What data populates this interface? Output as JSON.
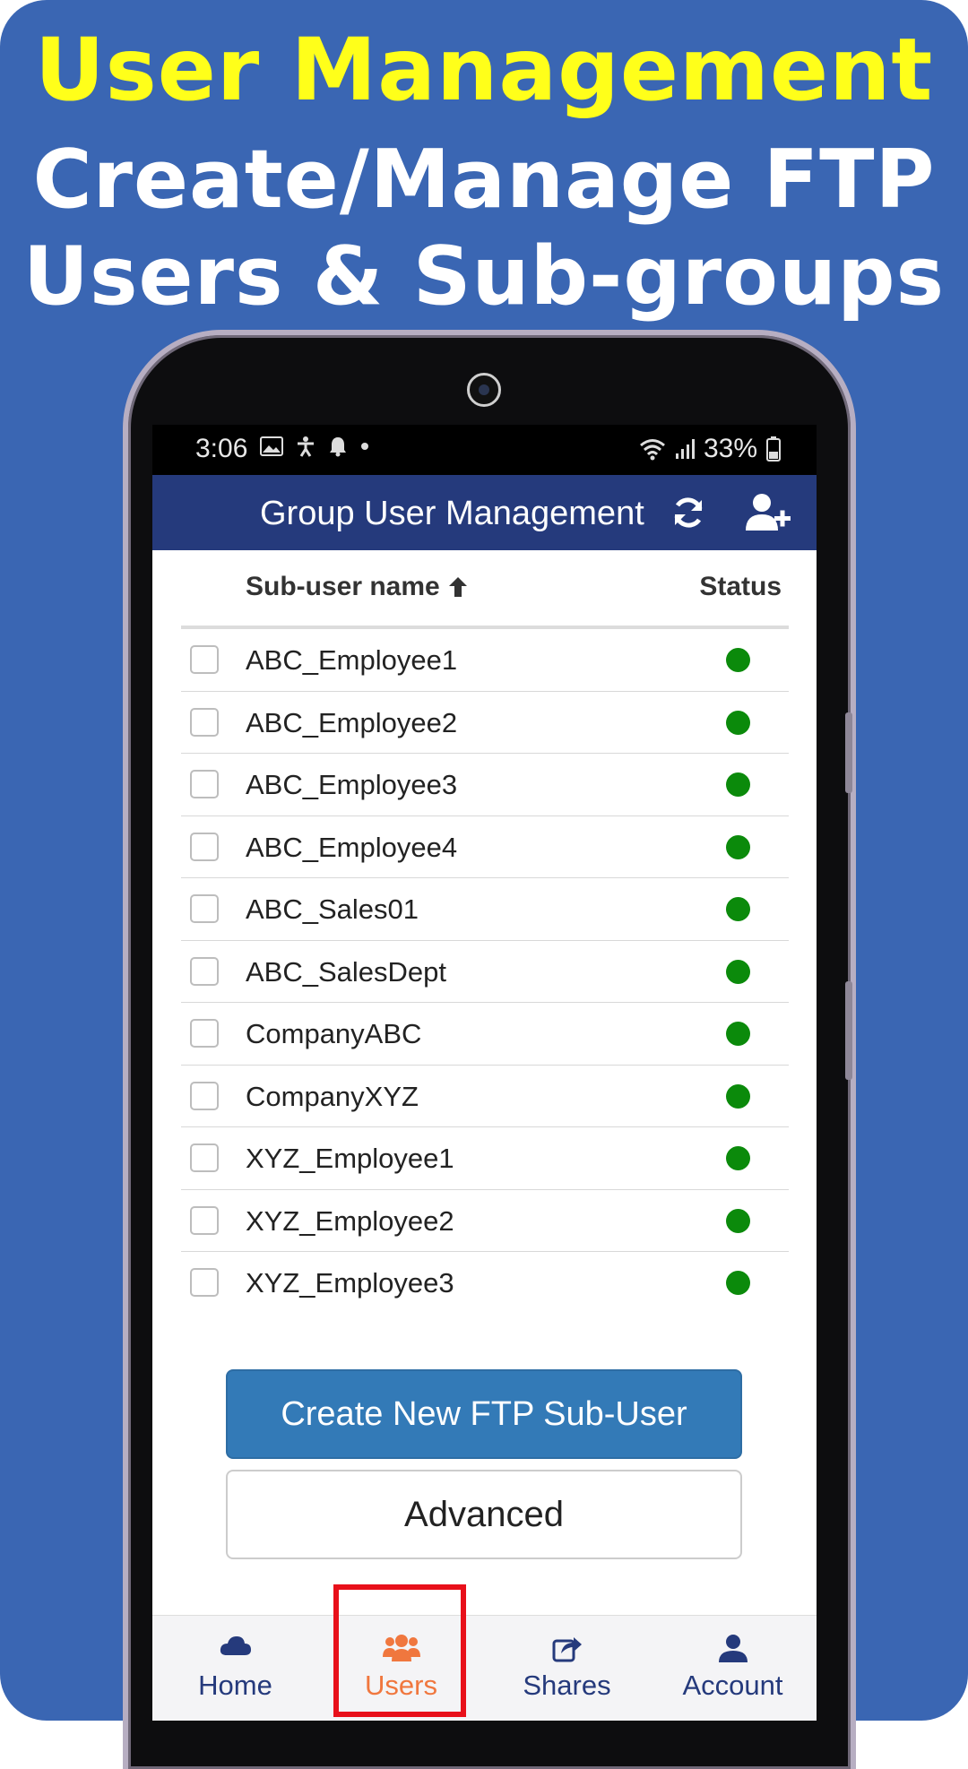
{
  "promo": {
    "title": "User Management",
    "subtitle_line1": "Create/Manage FTP",
    "subtitle_line2": "Users & Sub-groups"
  },
  "status_bar": {
    "time": "3:06",
    "battery": "33%",
    "left_icons": [
      "image-icon",
      "accessibility-icon",
      "bell-icon",
      "dot-icon"
    ],
    "right_icons": [
      "wifi-icon",
      "signal-icon",
      "battery-icon"
    ]
  },
  "app_bar": {
    "title": "Group User Management",
    "refresh_icon": "refresh-icon",
    "add_user_icon": "user-plus-icon"
  },
  "table": {
    "col_name": "Sub-user name",
    "sort_icon": "arrow-up-icon",
    "col_status": "Status",
    "rows": [
      {
        "name": "ABC_Employee1",
        "status": "active"
      },
      {
        "name": "ABC_Employee2",
        "status": "active"
      },
      {
        "name": "ABC_Employee3",
        "status": "active"
      },
      {
        "name": "ABC_Employee4",
        "status": "active"
      },
      {
        "name": "ABC_Sales01",
        "status": "active"
      },
      {
        "name": "ABC_SalesDept",
        "status": "active"
      },
      {
        "name": "CompanyABC",
        "status": "active"
      },
      {
        "name": "CompanyXYZ",
        "status": "active"
      },
      {
        "name": "XYZ_Employee1",
        "status": "active"
      },
      {
        "name": "XYZ_Employee2",
        "status": "active"
      },
      {
        "name": "XYZ_Employee3",
        "status": "active"
      }
    ]
  },
  "buttons": {
    "create": "Create New FTP Sub-User",
    "advanced": "Advanced"
  },
  "nav": {
    "items": [
      {
        "label": "Home",
        "icon": "cloud-icon",
        "active": false
      },
      {
        "label": "Users",
        "icon": "users-icon",
        "active": true
      },
      {
        "label": "Shares",
        "icon": "share-icon",
        "active": false
      },
      {
        "label": "Account",
        "icon": "person-icon",
        "active": false
      }
    ]
  },
  "colors": {
    "background": "#3a66b3",
    "title_yellow": "#ffff1a",
    "app_bar": "#253a7c",
    "primary_button": "#337ab7",
    "status_active": "#0b8a0b",
    "nav_active": "#f0773e",
    "highlight": "#e8101a"
  }
}
